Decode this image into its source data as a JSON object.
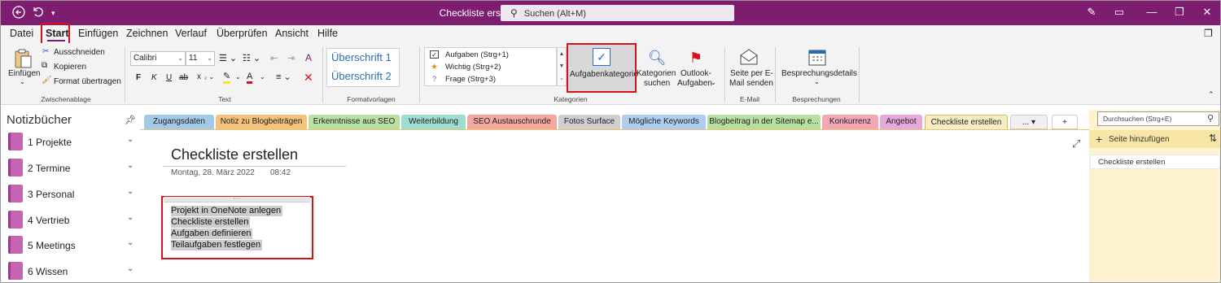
{
  "titlebar": {
    "title": "Checkliste erstellen  -  OneNote",
    "search_placeholder": "Suchen (Alt+M)",
    "back_icon": "back-arrow-icon",
    "undo_icon": "undo-icon",
    "qat_icon": "customize-qat-icon"
  },
  "menu": {
    "datei": "Datei",
    "start": "Start",
    "einfuegen": "Einfügen",
    "zeichnen": "Zeichnen",
    "verlauf": "Verlauf",
    "ueberpruefen": "Überprüfen",
    "ansicht": "Ansicht",
    "hilfe": "Hilfe"
  },
  "ribbon": {
    "clipboard": {
      "paste": "Einfügen",
      "cut": "Ausschneiden",
      "copy": "Kopieren",
      "format_painter": "Format übertragen",
      "label": "Zwischenablage"
    },
    "text": {
      "font": "Calibri",
      "size": "11",
      "bold": "F",
      "italic": "K",
      "underline": "U",
      "strike": "ab",
      "subscript": "x",
      "label": "Text"
    },
    "styles": {
      "h1": "Überschrift 1",
      "h2": "Überschrift 2",
      "label": "Formatvorlagen"
    },
    "tags": {
      "items": [
        "Aufgaben (Strg+1)",
        "Wichtig (Strg+2)",
        "Frage (Strg+3)"
      ],
      "aufgabenkategorie": "Aufgabenkategorie",
      "kategorien_1": "Kategorien",
      "kategorien_2": "suchen",
      "outlook_1": "Outlook-",
      "outlook_2": "Aufgaben",
      "label": "Kategorien"
    },
    "email": {
      "line1": "Seite per E-",
      "line2": "Mail senden",
      "label": "E-Mail"
    },
    "meetings": {
      "details": "Besprechungsdetails",
      "label": "Besprechungen"
    }
  },
  "sidebar": {
    "title": "Notizbücher",
    "notebooks": [
      "1 Projekte",
      "2 Termine",
      "3 Personal",
      "4 Vertrieb",
      "5 Meetings",
      "6 Wissen"
    ]
  },
  "tabs": [
    {
      "label": "Zugangsdaten",
      "color": "#a3c8e8"
    },
    {
      "label": "Notiz zu Blogbeiträgen",
      "color": "#f5c27e"
    },
    {
      "label": "Erkenntnisse aus SEO",
      "color": "#b8e0a0"
    },
    {
      "label": "Weiterbildung",
      "color": "#9fdcd2"
    },
    {
      "label": "SEO Austauschrunde",
      "color": "#f3a8a0"
    },
    {
      "label": "Fotos Surface",
      "color": "#cfcfcf"
    },
    {
      "label": "Mögliche Keywords",
      "color": "#aecdf0"
    },
    {
      "label": "Blogbeitrag in der Sitemap e...",
      "color": "#b7e09f"
    },
    {
      "label": "Konkurrenz",
      "color": "#f4a8b4"
    },
    {
      "label": "Angebot",
      "color": "#e7a8dc"
    },
    {
      "label": "Checkliste erstellen",
      "color": "#f7edc4"
    }
  ],
  "tabs_more": "...",
  "tabs_add": "+",
  "page": {
    "title": "Checkliste erstellen",
    "date": "Montag, 28. März 2022",
    "time": "08:42",
    "lines": [
      "Projekt in OneNote anlegen",
      "Checkliste erstellen",
      "Aufgaben definieren",
      "Teilaufgaben festlegen"
    ]
  },
  "right_pane": {
    "search_placeholder": "Durchsuchen (Strg+E)",
    "add_page": "Seite hinzufügen",
    "pages": [
      "Checkliste erstellen"
    ]
  },
  "colors": {
    "onenote_purple": "#7e1d6f",
    "highlight_red": "#d6111c"
  }
}
